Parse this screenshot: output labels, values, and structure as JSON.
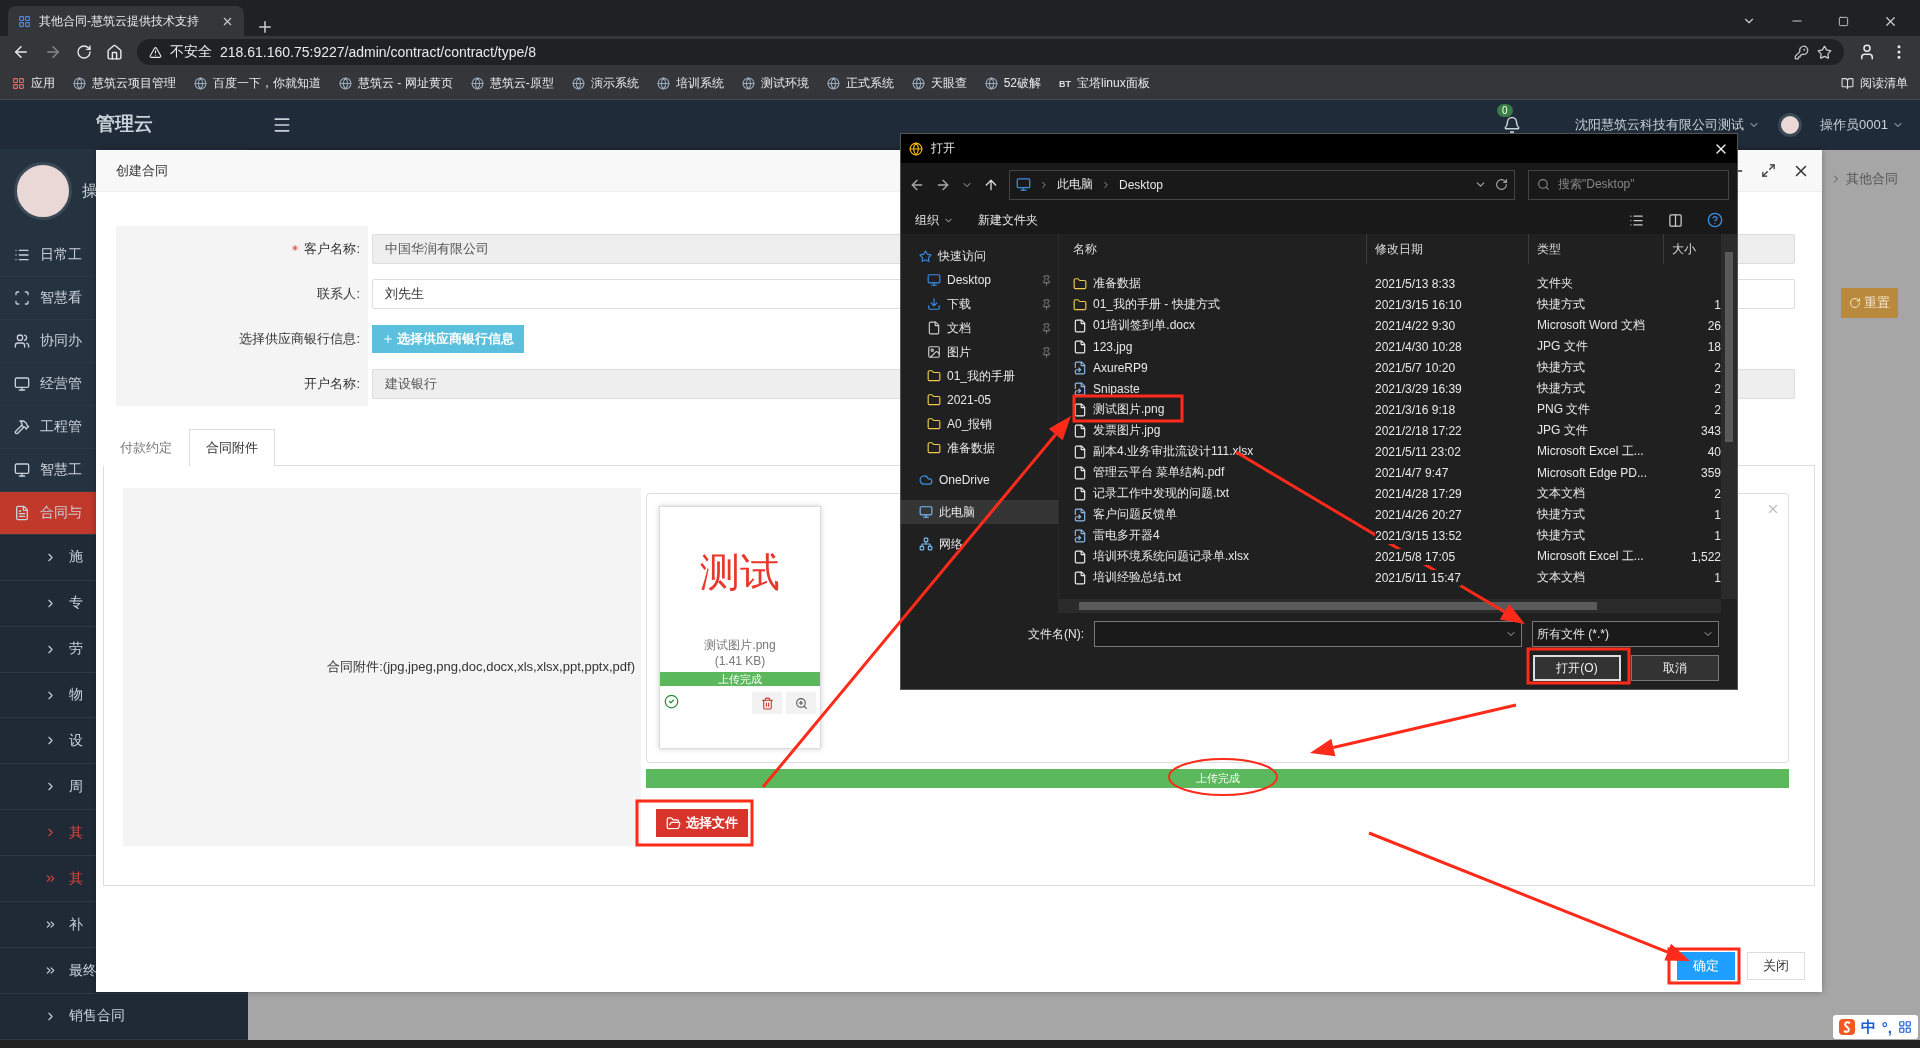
{
  "browser": {
    "tab_title": "其他合同-慧筑云提供技术支持",
    "url_warning": "不安全",
    "url": "218.61.160.75:9227/admin/contract/contract/type/8",
    "bookmarks": [
      {
        "label": "应用",
        "kind": "apps"
      },
      {
        "label": "慧筑云项目管理",
        "kind": "site"
      },
      {
        "label": "百度一下，你就知道",
        "kind": "site"
      },
      {
        "label": "慧筑云 - 网址黄页",
        "kind": "site"
      },
      {
        "label": "慧筑云-原型",
        "kind": "site"
      },
      {
        "label": "演示系统",
        "kind": "site"
      },
      {
        "label": "培训系统",
        "kind": "site"
      },
      {
        "label": "测试环境",
        "kind": "site"
      },
      {
        "label": "正式系统",
        "kind": "site"
      },
      {
        "label": "天眼查",
        "kind": "site"
      },
      {
        "label": "52破解",
        "kind": "site"
      },
      {
        "label": "宝塔linux面板",
        "kind": "text",
        "icon_text": "BT"
      }
    ],
    "reading_list": "阅读清单"
  },
  "app": {
    "logo": "管理云",
    "notification_count": "0",
    "company": "沈阳慧筑云科技有限公司测试",
    "user": "操作员0001",
    "sidebar_user": "操",
    "menu": [
      {
        "label": "日常工",
        "kind": "group",
        "selected": false
      },
      {
        "label": "智慧看",
        "kind": "group",
        "selected": false
      },
      {
        "label": "协同办",
        "kind": "group",
        "selected": false
      },
      {
        "label": "经营管",
        "kind": "group",
        "selected": false
      },
      {
        "label": "工程管",
        "kind": "group",
        "selected": false
      },
      {
        "label": "智慧工",
        "kind": "group",
        "selected": false
      },
      {
        "label": "合同与",
        "kind": "group",
        "selected": true
      },
      {
        "label": "施",
        "kind": "sub",
        "selected": false
      },
      {
        "label": "专",
        "kind": "sub",
        "selected": false
      },
      {
        "label": "劳",
        "kind": "sub",
        "selected": false
      },
      {
        "label": "物",
        "kind": "sub",
        "selected": false
      },
      {
        "label": "设",
        "kind": "sub",
        "selected": false
      },
      {
        "label": "周",
        "kind": "sub",
        "selected": false
      },
      {
        "label": "其",
        "kind": "sub",
        "selected": true
      },
      {
        "label": "其",
        "kind": "leaf",
        "selected": true
      },
      {
        "label": "补",
        "kind": "leaf",
        "selected": false
      },
      {
        "label": "最终",
        "kind": "leaf",
        "selected": false
      },
      {
        "label": "销售合同",
        "kind": "sub",
        "selected": false
      }
    ],
    "breadcrumb": "其他合同",
    "reset_button": "重置"
  },
  "modal": {
    "title": "创建合同",
    "fields": [
      {
        "label": "客户名称:",
        "required": true,
        "kind": "input",
        "value": "中国华润有限公司",
        "disabled": true
      },
      {
        "label": "联系人:",
        "required": false,
        "kind": "input",
        "value": "刘先生",
        "disabled": false
      },
      {
        "label": "选择供应商银行信息:",
        "required": false,
        "kind": "button",
        "button": "选择供应商银行信息"
      },
      {
        "label": "开户名称:",
        "required": false,
        "kind": "input",
        "value": "建设银行",
        "disabled": true
      }
    ],
    "tabs": [
      {
        "label": "付款约定",
        "selected": false
      },
      {
        "label": "合同附件",
        "selected": true
      }
    ],
    "attachment": {
      "label": "合同附件:(jpg,jpeg,png,doc,docx,xls,xlsx,ppt,pptx,pdf)",
      "file": {
        "preview_text": "测试",
        "name": "测试图片.png",
        "size": "(1.41 KB)",
        "status": "上传完成",
        "level": 1,
        "uploaded": true
      },
      "overall": {
        "status": "上传完成",
        "level": 1
      },
      "choose_button": "选择文件"
    },
    "buttons": [
      {
        "label": "确定",
        "kind": "primary"
      },
      {
        "label": "关闭",
        "kind": "default"
      }
    ]
  },
  "file_dialog": {
    "title": "打开",
    "path": [
      "此电脑",
      "Desktop"
    ],
    "search_placeholder": "搜索\"Desktop\"",
    "organize": "组织",
    "new_folder": "新建文件夹",
    "nav": [
      {
        "label": "快速访问",
        "kind": "star",
        "pinned": false,
        "selected": false
      },
      {
        "label": "Desktop",
        "kind": "desktop",
        "pinned": true,
        "selected": false
      },
      {
        "label": "下载",
        "kind": "download",
        "pinned": true,
        "selected": false
      },
      {
        "label": "文档",
        "kind": "docs",
        "pinned": true,
        "selected": false
      },
      {
        "label": "图片",
        "kind": "pictures",
        "pinned": true,
        "selected": false
      },
      {
        "label": "01_我的手册",
        "kind": "folder",
        "pinned": false,
        "selected": false
      },
      {
        "label": "2021-05",
        "kind": "folder",
        "pinned": false,
        "selected": false
      },
      {
        "label": "A0_报销",
        "kind": "folder",
        "pinned": false,
        "selected": false
      },
      {
        "label": "准备数据",
        "kind": "folder",
        "pinned": false,
        "selected": false
      },
      {
        "label": "OneDrive",
        "kind": "cloud",
        "pinned": false,
        "selected": false
      },
      {
        "label": "此电脑",
        "kind": "pc",
        "pinned": false,
        "selected": true
      },
      {
        "label": "网络",
        "kind": "network",
        "pinned": false,
        "selected": false
      }
    ],
    "columns": [
      "名称",
      "修改日期",
      "类型",
      "大小"
    ],
    "rows": [
      {
        "name": "准备数据",
        "kind": "folder",
        "date": "2021/5/13 8:33",
        "type": "文件夹"
      },
      {
        "name": "01_我的手册 - 快捷方式",
        "kind": "folder",
        "date": "2021/3/15 16:10",
        "type": "快捷方式",
        "size": "1"
      },
      {
        "name": "01培训签到单.docx",
        "kind": "file",
        "date": "2021/4/22 9:30",
        "type": "Microsoft Word 文档",
        "size": "26"
      },
      {
        "name": "123.jpg",
        "kind": "file",
        "date": "2021/4/30 10:28",
        "type": "JPG 文件",
        "size": "18"
      },
      {
        "name": "AxureRP9",
        "kind": "shortcut",
        "date": "2021/5/7 10:20",
        "type": "快捷方式",
        "size": "2"
      },
      {
        "name": "Snipaste",
        "kind": "shortcut",
        "date": "2021/3/29 16:39",
        "type": "快捷方式",
        "size": "2"
      },
      {
        "name": "测试图片.png",
        "kind": "file",
        "date": "2021/3/16 9:18",
        "type": "PNG 文件",
        "size": "2"
      },
      {
        "name": "发票图片.jpg",
        "kind": "file",
        "date": "2021/2/18 17:22",
        "type": "JPG 文件",
        "size": "343"
      },
      {
        "name": "副本4.业务审批流设计111.xlsx",
        "kind": "file",
        "date": "2021/5/11 23:02",
        "type": "Microsoft Excel 工...",
        "size": "40"
      },
      {
        "name": "管理云平台 菜单结构.pdf",
        "kind": "file",
        "date": "2021/4/7 9:47",
        "type": "Microsoft Edge PD...",
        "size": "359"
      },
      {
        "name": "记录工作中发现的问题.txt",
        "kind": "file",
        "date": "2021/4/28 17:29",
        "type": "文本文档",
        "size": "2"
      },
      {
        "name": "客户问题反馈单",
        "kind": "shortcut",
        "date": "2021/4/26 20:27",
        "type": "快捷方式",
        "size": "1"
      },
      {
        "name": "雷电多开器4",
        "kind": "shortcut",
        "date": "2021/3/15 13:52",
        "type": "快捷方式",
        "size": "1"
      },
      {
        "name": "培训环境系统问题记录单.xlsx",
        "kind": "file",
        "date": "2021/5/8 17:05",
        "type": "Microsoft Excel 工...",
        "size": "1,522"
      },
      {
        "name": "培训经验总结.txt",
        "kind": "file",
        "date": "2021/5/11 15:47",
        "type": "文本文档",
        "size": "1"
      }
    ],
    "filename_label": "文件名(N):",
    "filetype": "所有文件 (*.*)",
    "buttons": [
      {
        "label": "打开(O)",
        "kind": "primary"
      },
      {
        "label": "取消",
        "kind": "default"
      }
    ]
  },
  "ime": {
    "labels": [
      "中",
      "°,"
    ]
  }
}
